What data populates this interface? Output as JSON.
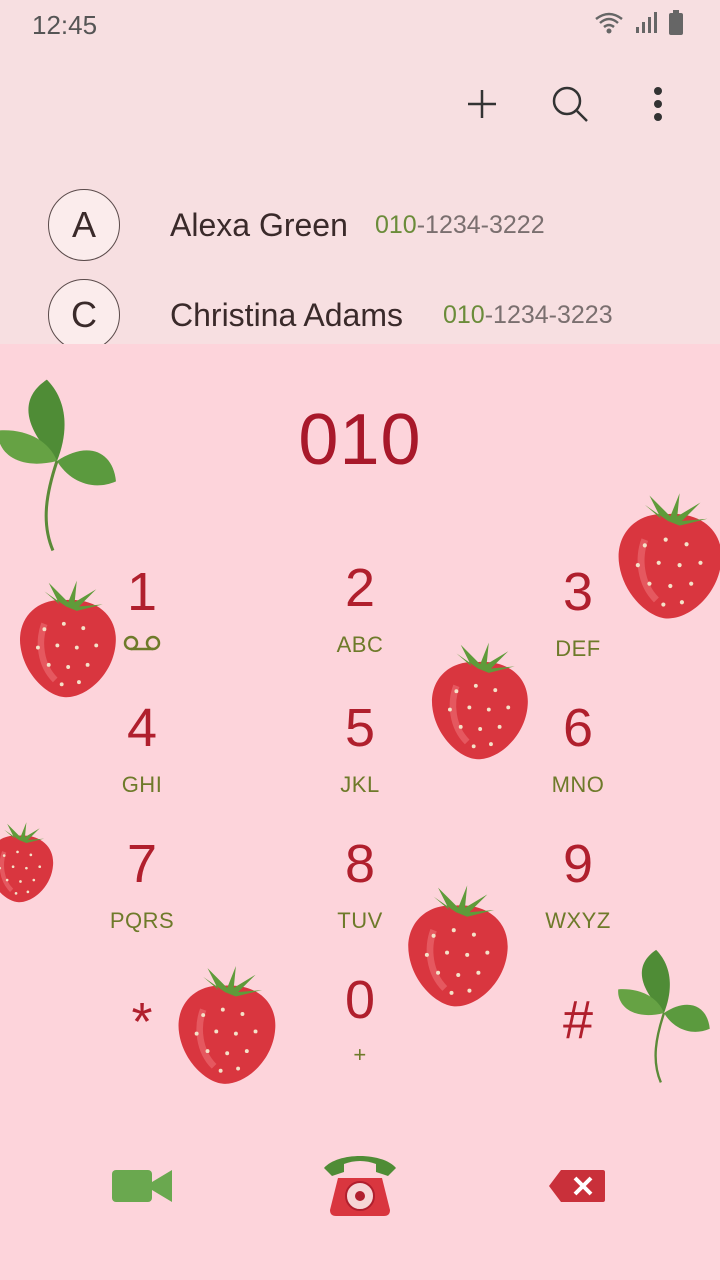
{
  "status_bar": {
    "time": "12:45"
  },
  "actions": {
    "add_icon": "plus-icon",
    "search_icon": "search-icon",
    "more_icon": "more-vertical-icon"
  },
  "contacts": [
    {
      "initial": "A",
      "name": "Alexa Green",
      "number_match": "010",
      "number_rest": "-1234-3222"
    },
    {
      "initial": "C",
      "name": "Christina Adams",
      "number_match": "010",
      "number_rest": "-1234-3223"
    }
  ],
  "dialer": {
    "entered_number": "010",
    "keys": [
      {
        "digit": "1",
        "letters": ""
      },
      {
        "digit": "2",
        "letters": "ABC"
      },
      {
        "digit": "3",
        "letters": "DEF"
      },
      {
        "digit": "4",
        "letters": "GHI"
      },
      {
        "digit": "5",
        "letters": "JKL"
      },
      {
        "digit": "6",
        "letters": "MNO"
      },
      {
        "digit": "7",
        "letters": "PQRS"
      },
      {
        "digit": "8",
        "letters": "TUV"
      },
      {
        "digit": "9",
        "letters": "WXYZ"
      },
      {
        "digit": "*",
        "letters": ""
      },
      {
        "digit": "0",
        "letters": "+"
      },
      {
        "digit": "#",
        "letters": ""
      }
    ]
  },
  "bottom_bar": {
    "video_icon": "video-call-icon",
    "call_icon": "phone-call-icon",
    "delete_icon": "backspace-icon"
  },
  "colors": {
    "accent": "#b01f2d",
    "letters": "#6e7a2a",
    "panel": "#fdd4db",
    "header": "#f7dfe1"
  }
}
